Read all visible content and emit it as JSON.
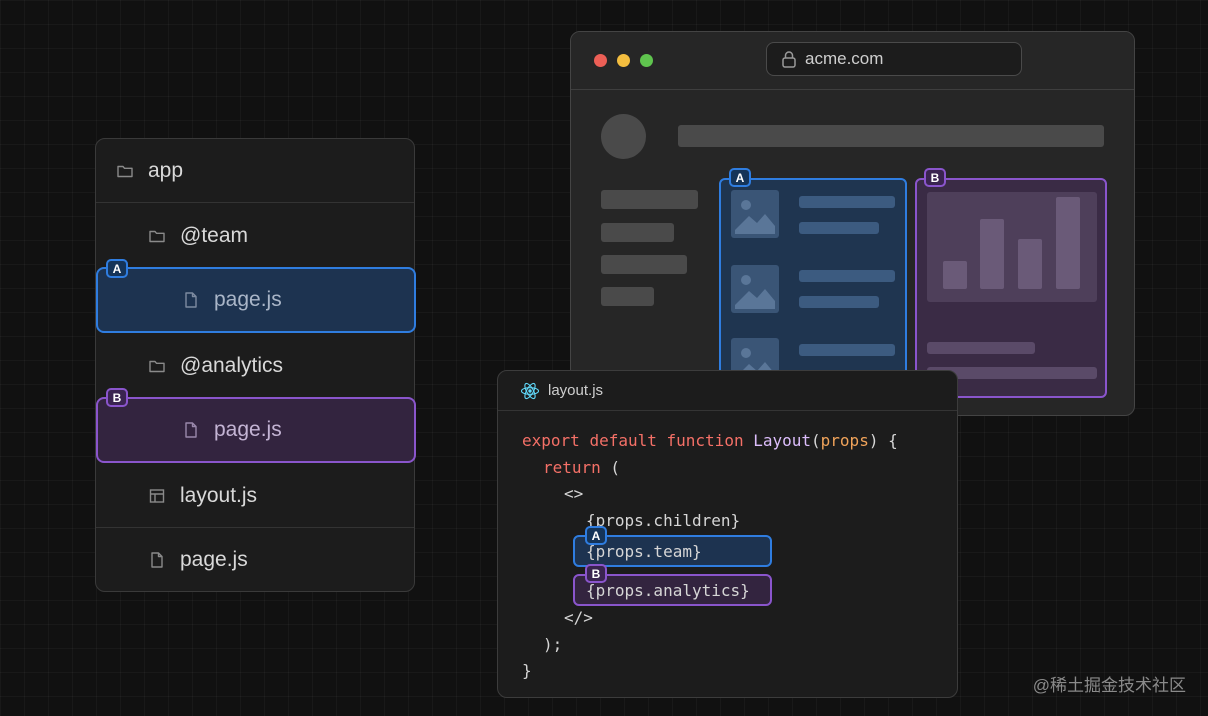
{
  "tree": {
    "root": "app",
    "team_folder": "@team",
    "team_page": "page.js",
    "analytics_folder": "@analytics",
    "analytics_page": "page.js",
    "layout_file": "layout.js",
    "root_page": "page.js"
  },
  "tags": {
    "a": "A",
    "b": "B"
  },
  "browser": {
    "url": "acme.com"
  },
  "code": {
    "filename": "layout.js",
    "l1_export": "export",
    "l1_default": "default",
    "l1_function": "function",
    "l1_name": "Layout",
    "l1_open": "(",
    "l1_param": "props",
    "l1_close": ") {",
    "l2_return": "return",
    "l2_paren": " (",
    "l3": "<>",
    "l4": "{props.children}",
    "l5": "{props.team}",
    "l6": "{props.analytics}",
    "l7": "</>",
    "l8": ");",
    "l9": "}"
  },
  "watermark": "@稀土掘金技术社区",
  "colors": {
    "slot_a": "#2f7de0",
    "slot_b": "#8a55cc",
    "background": "#111111"
  },
  "icons": [
    "folder-icon",
    "file-icon",
    "layout-icon",
    "lock-icon",
    "react-icon",
    "image-icon"
  ]
}
